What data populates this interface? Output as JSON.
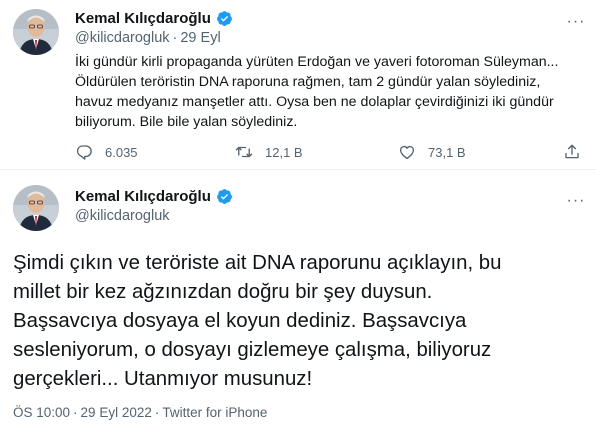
{
  "tweet1": {
    "author_name": "Kemal Kılıçdaroğlu",
    "handle": "@kilicdarogluk",
    "separator": "·",
    "date": "29 Eyl",
    "more_label": "···",
    "text_lines": [
      "İki gündür kirli propaganda yürüten Erdoğan ve yaveri fotoroman Süleyman...",
      "Öldürülen teröristin DNA raporuna rağmen, tam 2 gündür yalan söylediniz,",
      "havuz medyanız manşetler attı. Oysa ben ne dolaplar çevirdiğinizi iki gündür",
      "biliyorum. Bile bile yalan söylediniz."
    ],
    "replies": "6.035",
    "retweets": "12,1 B",
    "likes": "73,1 B",
    "icons": [
      "reply-icon",
      "retweet-icon",
      "like-icon",
      "share-icon"
    ]
  },
  "tweet2": {
    "author_name": "Kemal Kılıçdaroğlu",
    "handle": "@kilicdarogluk",
    "more_label": "···",
    "text_lines": [
      "Şimdi çıkın ve teröriste ait DNA raporunu açıklayın, bu",
      "millet bir kez ağzınızdan doğru bir şey duysun.",
      "Başsavcıya dosyaya el koyun dediniz. Başsavcıya",
      "sesleniyorum, o dosyayı gizlemeye çalışma, biliyoruz",
      "gerçekleri... Utanmıyor musunuz!"
    ],
    "time": "ÖS 10:00",
    "separator": "·",
    "full_date": "29 Eyl 2022",
    "source": "Twitter for iPhone"
  },
  "colors": {
    "verified": "#1d9bf0",
    "secondary_text": "#536471",
    "primary_text": "#0f1419",
    "divider": "#eff3f4"
  }
}
